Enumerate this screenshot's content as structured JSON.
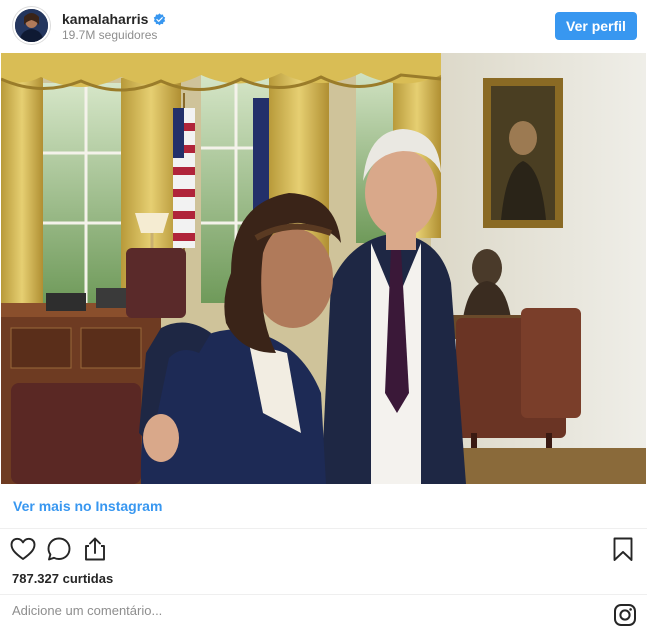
{
  "header": {
    "username": "kamalaharris",
    "followers": "19.7M seguidores",
    "profile_button": "Ver perfil",
    "verified_icon": "verified-badge-icon"
  },
  "post": {
    "image_icon": "photo",
    "view_more_link": "Ver mais no Instagram",
    "likes": "787.327 curtidas",
    "comment_placeholder": "Adicione um comentário..."
  },
  "actions": {
    "like_icon": "heart-icon",
    "comment_icon": "comment-icon",
    "share_icon": "share-icon",
    "save_icon": "bookmark-icon",
    "instagram_icon": "instagram-icon"
  },
  "colors": {
    "accent": "#3897f0",
    "text": "#262626",
    "muted": "#8e8e8e",
    "divider": "#efefef"
  }
}
